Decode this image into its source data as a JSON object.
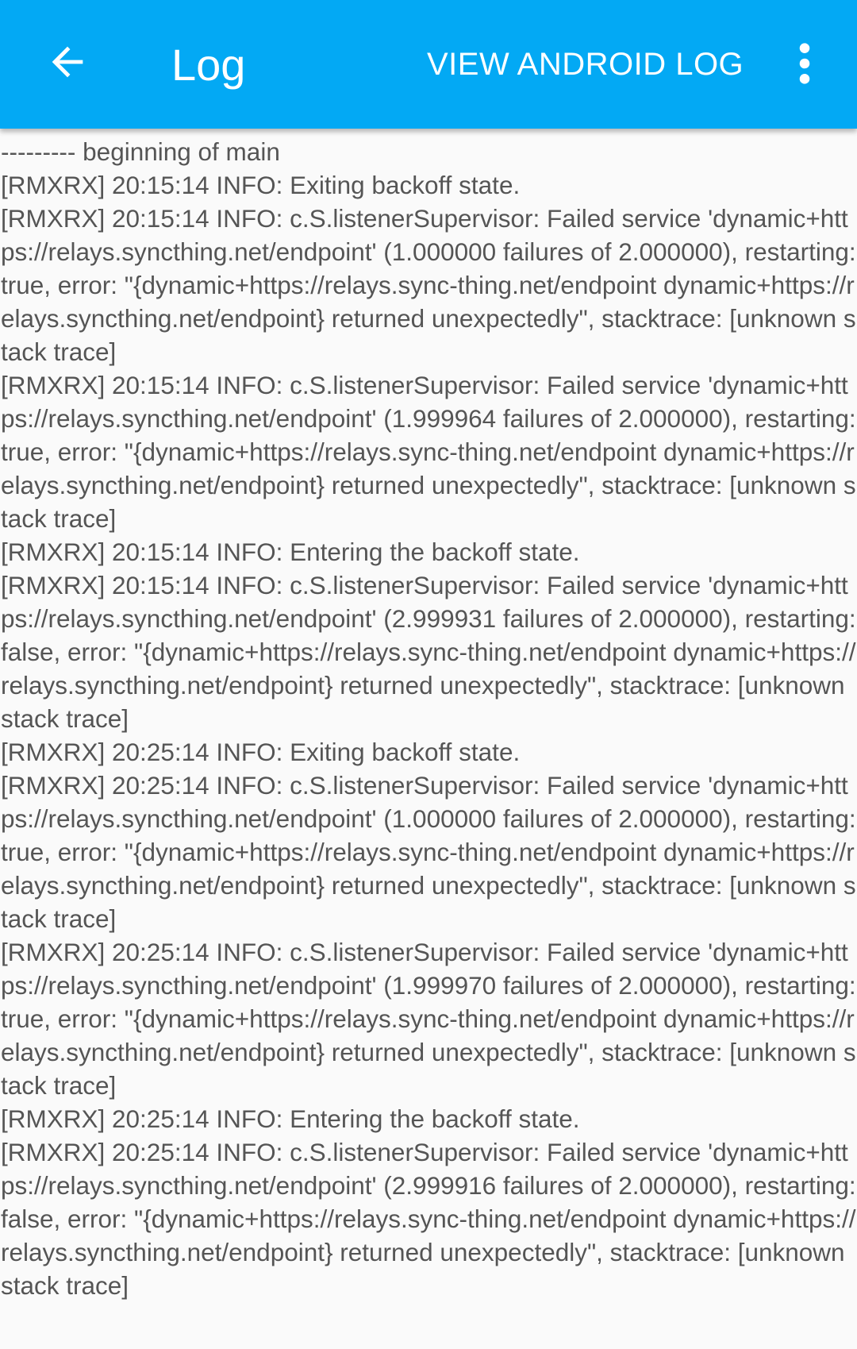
{
  "toolbar": {
    "back_icon": "arrow-back-icon",
    "title": "Log",
    "action_label": "VIEW ANDROID LOG",
    "overflow_icon": "more-vert-icon",
    "background_color": "#03a9f4",
    "text_color": "#ffffff"
  },
  "log": {
    "text": "--------- beginning of main\n[RMXRX] 20:15:14 INFO: Exiting backoff state.\n[RMXRX] 20:15:14 INFO: c.S.listenerSupervisor: Failed service 'dynamic+https://relays.syncthing.net/endpoint' (1.000000 failures of 2.000000), restarting: true, error: \"{dynamic+https://relays.sync-thing.net/endpoint dynamic+https://relays.syncthing.net/endpoint} returned unexpectedly\", stacktrace: [unknown stack trace]\n[RMXRX] 20:15:14 INFO: c.S.listenerSupervisor: Failed service 'dynamic+https://relays.syncthing.net/endpoint' (1.999964 failures of 2.000000), restarting: true, error: \"{dynamic+https://relays.sync-thing.net/endpoint dynamic+https://relays.syncthing.net/endpoint} returned unexpectedly\", stacktrace: [unknown stack trace]\n[RMXRX] 20:15:14 INFO: Entering the backoff state.\n[RMXRX] 20:15:14 INFO: c.S.listenerSupervisor: Failed service 'dynamic+https://relays.syncthing.net/endpoint' (2.999931 failures of 2.000000), restarting: false, error: \"{dynamic+https://relays.sync-thing.net/endpoint dynamic+https://relays.syncthing.net/endpoint} returned unexpectedly\", stacktrace: [unknown stack trace]\n[RMXRX] 20:25:14 INFO: Exiting backoff state.\n[RMXRX] 20:25:14 INFO: c.S.listenerSupervisor: Failed service 'dynamic+https://relays.syncthing.net/endpoint' (1.000000 failures of 2.000000), restarting: true, error: \"{dynamic+https://relays.sync-thing.net/endpoint dynamic+https://relays.syncthing.net/endpoint} returned unexpectedly\", stacktrace: [unknown stack trace]\n[RMXRX] 20:25:14 INFO: c.S.listenerSupervisor: Failed service 'dynamic+https://relays.syncthing.net/endpoint' (1.999970 failures of 2.000000), restarting: true, error: \"{dynamic+https://relays.sync-thing.net/endpoint dynamic+https://relays.syncthing.net/endpoint} returned unexpectedly\", stacktrace: [unknown stack trace]\n[RMXRX] 20:25:14 INFO: Entering the backoff state.\n[RMXRX] 20:25:14 INFO: c.S.listenerSupervisor: Failed service 'dynamic+https://relays.syncthing.net/endpoint' (2.999916 failures of 2.000000), restarting: false, error: \"{dynamic+https://relays.sync-thing.net/endpoint dynamic+https://relays.syncthing.net/endpoint} returned unexpectedly\", stacktrace: [unknown stack trace]",
    "text_color": "#555555",
    "background_color": "#fafafa"
  }
}
